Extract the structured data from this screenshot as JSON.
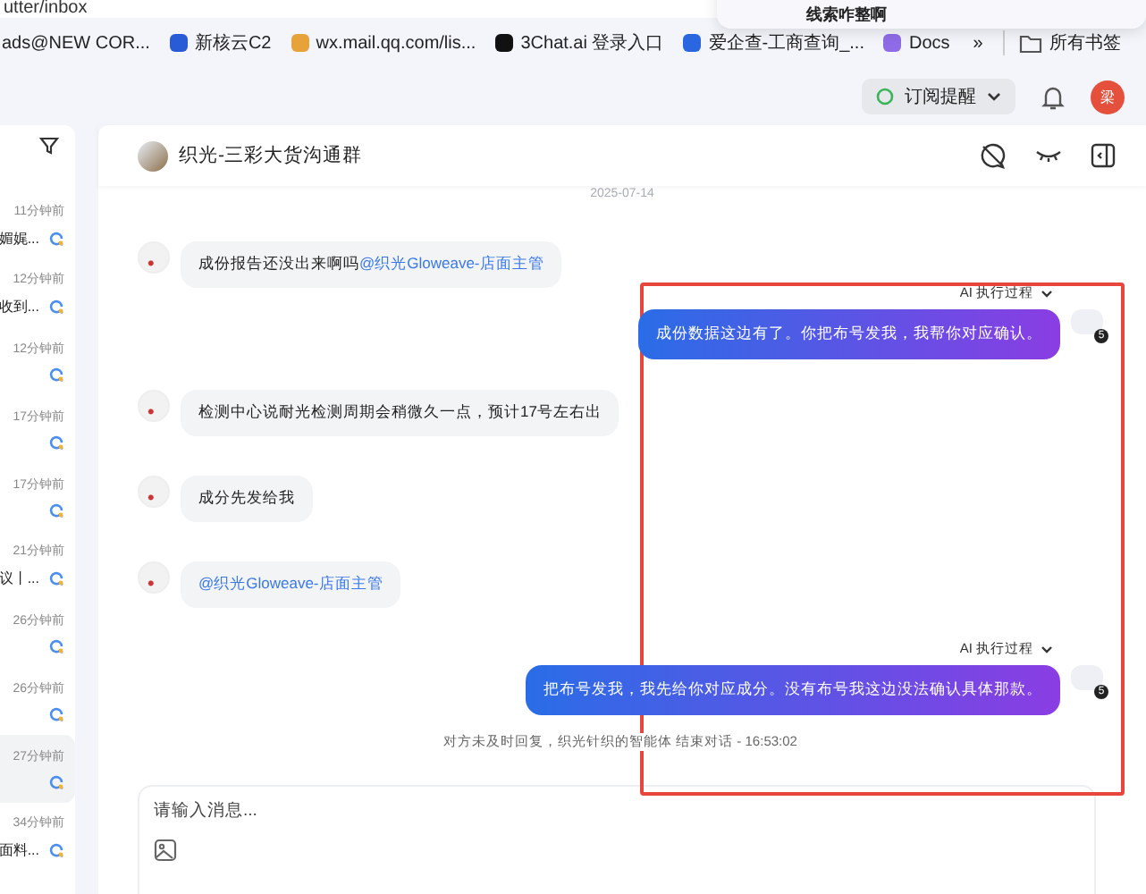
{
  "browser": {
    "url": "utter/inbox",
    "notification": "线索咋整啊",
    "bookmarks": [
      {
        "label": "ads@NEW COR...",
        "kind": "none"
      },
      {
        "label": "新核云C2",
        "kind": "cloud"
      },
      {
        "label": "wx.mail.qq.com/lis...",
        "kind": "mail"
      },
      {
        "label": "3Chat.ai 登录入口",
        "kind": "chat"
      },
      {
        "label": "爱企查-工商查询_...",
        "kind": "search"
      },
      {
        "label": "Docs",
        "kind": "docs"
      }
    ],
    "more": "»",
    "all_bookmarks": "所有书签"
  },
  "topbar": {
    "subscribe": "订阅提醒",
    "user_initial": "梁"
  },
  "sidebar": {
    "items": [
      {
        "time": "11分钟前",
        "snippet": "媚娓...",
        "selected": false
      },
      {
        "time": "12分钟前",
        "snippet": "收到...",
        "selected": false
      },
      {
        "time": "12分钟前",
        "selected": false
      },
      {
        "time": "17分钟前",
        "selected": false
      },
      {
        "time": "17分钟前",
        "selected": false
      },
      {
        "time": "21分钟前",
        "snippet": "议丨...",
        "selected": false
      },
      {
        "time": "26分钟前",
        "selected": false
      },
      {
        "time": "26分钟前",
        "selected": false
      },
      {
        "time": "27分钟前",
        "selected": true
      },
      {
        "time": "34分钟前",
        "snippet": "面料...",
        "selected": false
      }
    ]
  },
  "chat": {
    "title": "织光-三彩大货沟通群",
    "date": "2025-07-14",
    "messages": [
      {
        "kind": "incoming",
        "parts": [
          {
            "kind": "text",
            "text": "成份报告还没出来啊吗"
          },
          {
            "kind": "mention",
            "text": "@织光Gloweave-店面主管"
          }
        ]
      },
      {
        "kind": "outgoing",
        "ai_label": "AI 执行过程",
        "badge": "5",
        "parts": [
          {
            "kind": "text",
            "text": "成份数据这边有了。你把布号发我，我帮你对应确认。"
          }
        ]
      },
      {
        "kind": "incoming",
        "parts": [
          {
            "kind": "text",
            "text": "检测中心说耐光检测周期会稍微久一点，预计17号左右出"
          }
        ]
      },
      {
        "kind": "incoming",
        "parts": [
          {
            "kind": "text",
            "text": "成分先发给我"
          }
        ]
      },
      {
        "kind": "incoming",
        "parts": [
          {
            "kind": "mention",
            "text": "@织光Gloweave-店面主管"
          }
        ]
      },
      {
        "kind": "outgoing",
        "ai_label": "AI 执行过程",
        "badge": "5",
        "parts": [
          {
            "kind": "text",
            "text": "把布号发我，我先给你对应成分。没有布号我这边没法确认具体那款。"
          }
        ]
      }
    ],
    "system_note": "对方未及时回复，织光针织的智能体 结束对话 - 16:53:02",
    "input": {
      "placeholder": "请输入消息..."
    }
  }
}
